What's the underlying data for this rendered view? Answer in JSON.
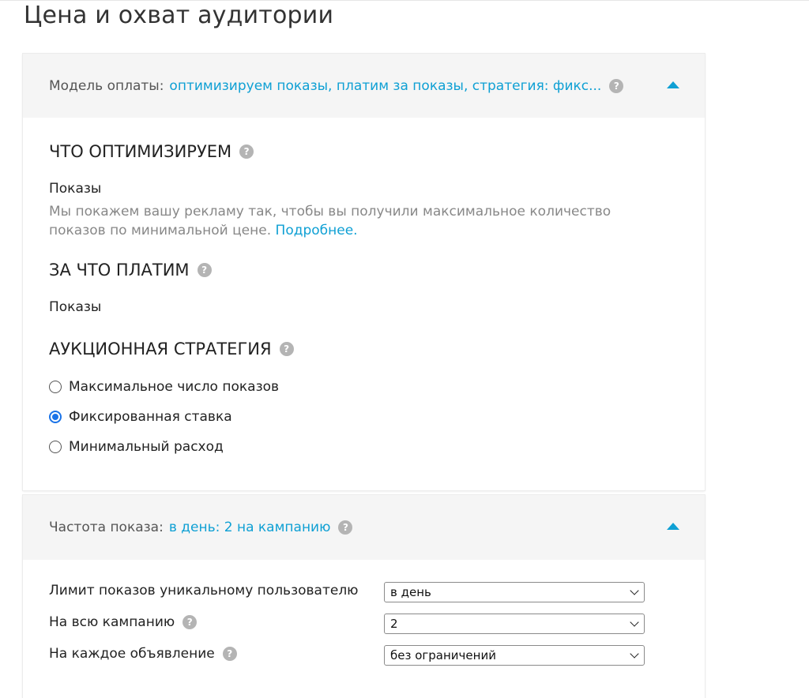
{
  "page": {
    "title": "Цена и охват аудитории"
  },
  "payment": {
    "label": "Модель оплаты:",
    "value": "оптимизируем показы, платим за показы, стратегия: фикс...",
    "help": "?"
  },
  "optimize": {
    "title": "ЧТО ОПТИМИЗИРУЕМ",
    "value": "Показы",
    "description": "Мы покажем вашу рекламу так, чтобы вы получили максимальное количество показов по минимальной цене.",
    "link": "Подробнее."
  },
  "pay_for": {
    "title": "ЗА ЧТО ПЛАТИМ",
    "value": "Показы"
  },
  "strategy": {
    "title": "АУКЦИОННАЯ СТРАТЕГИЯ",
    "options": [
      {
        "label": "Максимальное число показов",
        "checked": false
      },
      {
        "label": "Фиксированная ставка",
        "checked": true
      },
      {
        "label": "Минимальный расход",
        "checked": false
      }
    ]
  },
  "frequency": {
    "label": "Частота показа:",
    "value": "в день: 2 на кампанию",
    "rows": [
      {
        "label": "Лимит показов уникальному пользователю",
        "value": "в день",
        "help": false
      },
      {
        "label": "На всю кампанию",
        "value": "2",
        "help": true
      },
      {
        "label": "На каждое объявление",
        "value": "без ограничений",
        "help": true
      }
    ]
  },
  "colors": {
    "accent": "#0fa0d4",
    "radio": "#1a73e8",
    "header_bg": "#f5f5f5"
  }
}
